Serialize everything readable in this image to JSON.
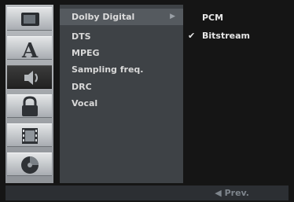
{
  "menu": {
    "items": [
      {
        "label": "Dolby Digital",
        "selected": true
      },
      {
        "label": "DTS",
        "selected": false
      },
      {
        "label": "MPEG",
        "selected": false
      },
      {
        "label": "Sampling freq.",
        "selected": false
      },
      {
        "label": "DRC",
        "selected": false
      },
      {
        "label": "Vocal",
        "selected": false
      }
    ]
  },
  "options": {
    "items": [
      {
        "label": "PCM",
        "checked": false
      },
      {
        "label": "Bitstream",
        "checked": true
      }
    ]
  },
  "icons": [
    "display-icon",
    "language-icon",
    "audio-icon",
    "lock-icon",
    "film-icon",
    "disc-icon"
  ],
  "footer": {
    "prev_label": "◀ Prev."
  },
  "glyphs": {
    "submenu_arrow": "▶",
    "check": "✔"
  },
  "colors": {
    "menu_bg": "#3e4246",
    "selected_bg": "#555a5f",
    "text": "#d8d8d8"
  }
}
